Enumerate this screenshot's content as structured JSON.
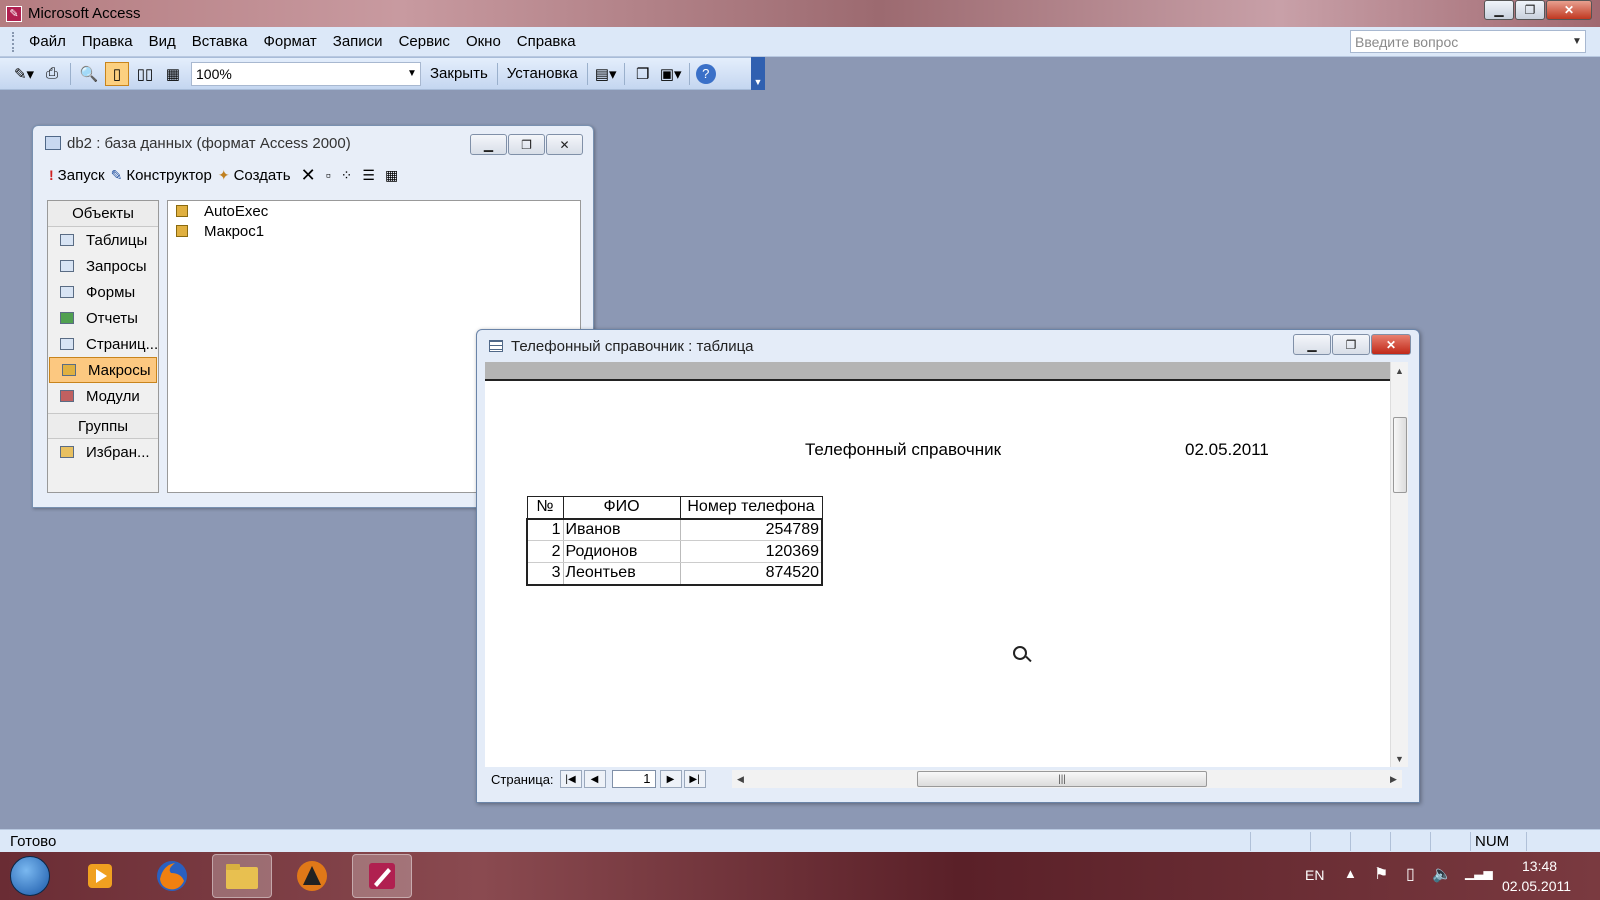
{
  "app": {
    "title": "Microsoft Access",
    "menu": [
      "Файл",
      "Правка",
      "Вид",
      "Вставка",
      "Формат",
      "Записи",
      "Сервис",
      "Окно",
      "Справка"
    ],
    "help_placeholder": "Введите вопрос"
  },
  "toolbar": {
    "zoom_value": "100%",
    "close_label": "Закрыть",
    "setup_label": "Установка"
  },
  "dbwindow": {
    "title": "db2 : база данных (формат Access 2000)",
    "run_label": "Запуск",
    "design_label": "Конструктор",
    "create_label": "Создать",
    "objects_header": "Объекты",
    "objects": [
      "Таблицы",
      "Запросы",
      "Формы",
      "Отчеты",
      "Страниц...",
      "Макросы",
      "Модули"
    ],
    "selected_object": "Макросы",
    "groups_header": "Группы",
    "groups": [
      "Избран..."
    ],
    "items": [
      "AutoExec",
      "Макрос1"
    ]
  },
  "preview": {
    "title": "Телефонный справочник : таблица",
    "report_title": "Телефонный справочник",
    "report_date": "02.05.2011",
    "columns": [
      "№",
      "ФИО",
      "Номер телефона"
    ],
    "rows": [
      {
        "n": "1",
        "fio": "Иванов",
        "phone": "254789"
      },
      {
        "n": "2",
        "fio": "Родионов",
        "phone": "120369"
      },
      {
        "n": "3",
        "fio": "Леонтьев",
        "phone": "874520"
      }
    ],
    "page_label": "Страница:",
    "page_value": "1"
  },
  "status": {
    "text": "Готово",
    "num": "NUM"
  },
  "taskbar": {
    "lang": "EN",
    "time": "13:48",
    "date": "02.05.2011"
  }
}
